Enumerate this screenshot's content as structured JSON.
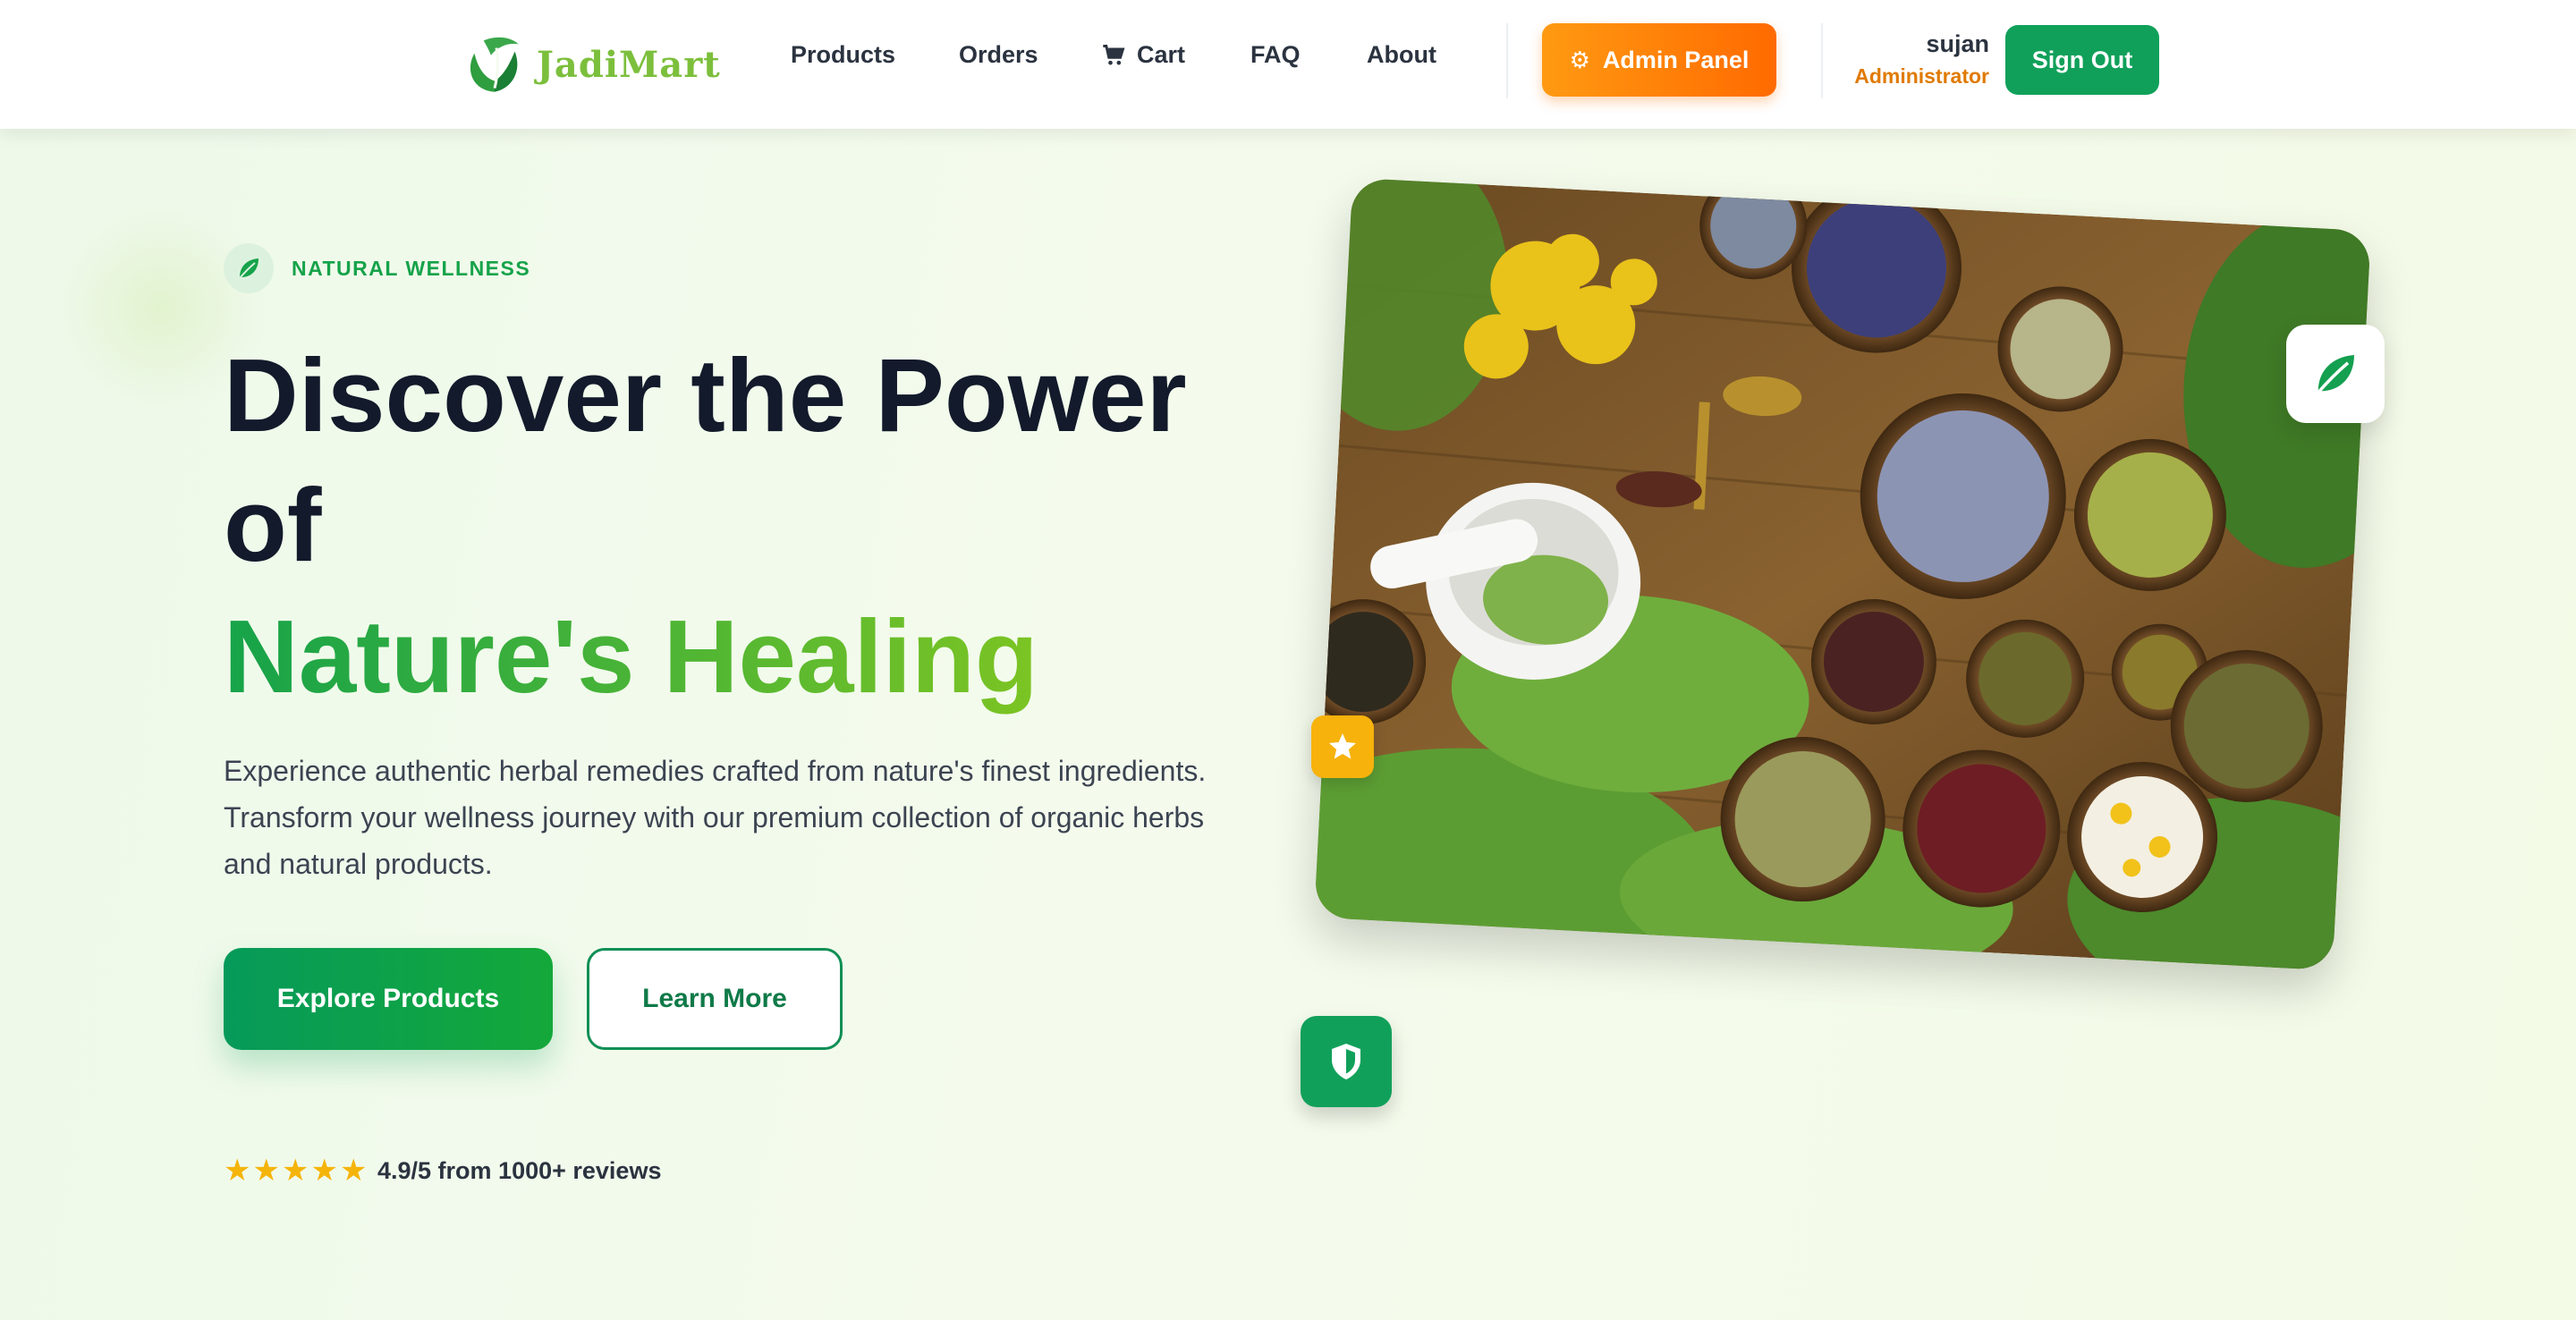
{
  "brand": {
    "name": "JadiMart",
    "accent": "#7cbf3c",
    "primary_green": "#10a05a",
    "orange": "#ff7a00"
  },
  "nav": {
    "items": [
      {
        "label": "Products"
      },
      {
        "label": "Orders"
      },
      {
        "label": "Cart",
        "icon": "cart-icon"
      },
      {
        "label": "FAQ"
      },
      {
        "label": "About"
      }
    ],
    "admin_label": "Admin Panel",
    "admin_icon": "gear-icon",
    "user": {
      "name": "sujan",
      "role": "Administrator"
    },
    "signout_label": "Sign Out"
  },
  "hero": {
    "badge": "NATURAL WELLNESS",
    "badge_icon": "leaf-icon",
    "headline_line1": "Discover the Power",
    "headline_line2": "of",
    "headline_highlight": "Nature's Healing",
    "description": "Experience authentic herbal remedies crafted from nature's finest ingredients. Transform your wellness journey with our premium collection of organic herbs and natural products.",
    "primary_cta": "Explore Products",
    "secondary_cta": "Learn More",
    "rating": {
      "stars": 5,
      "text": "4.9/5 from 1000+ reviews"
    }
  },
  "image_card": {
    "floating_icons": [
      "leaf-icon",
      "star-icon",
      "shield-icon"
    ]
  }
}
